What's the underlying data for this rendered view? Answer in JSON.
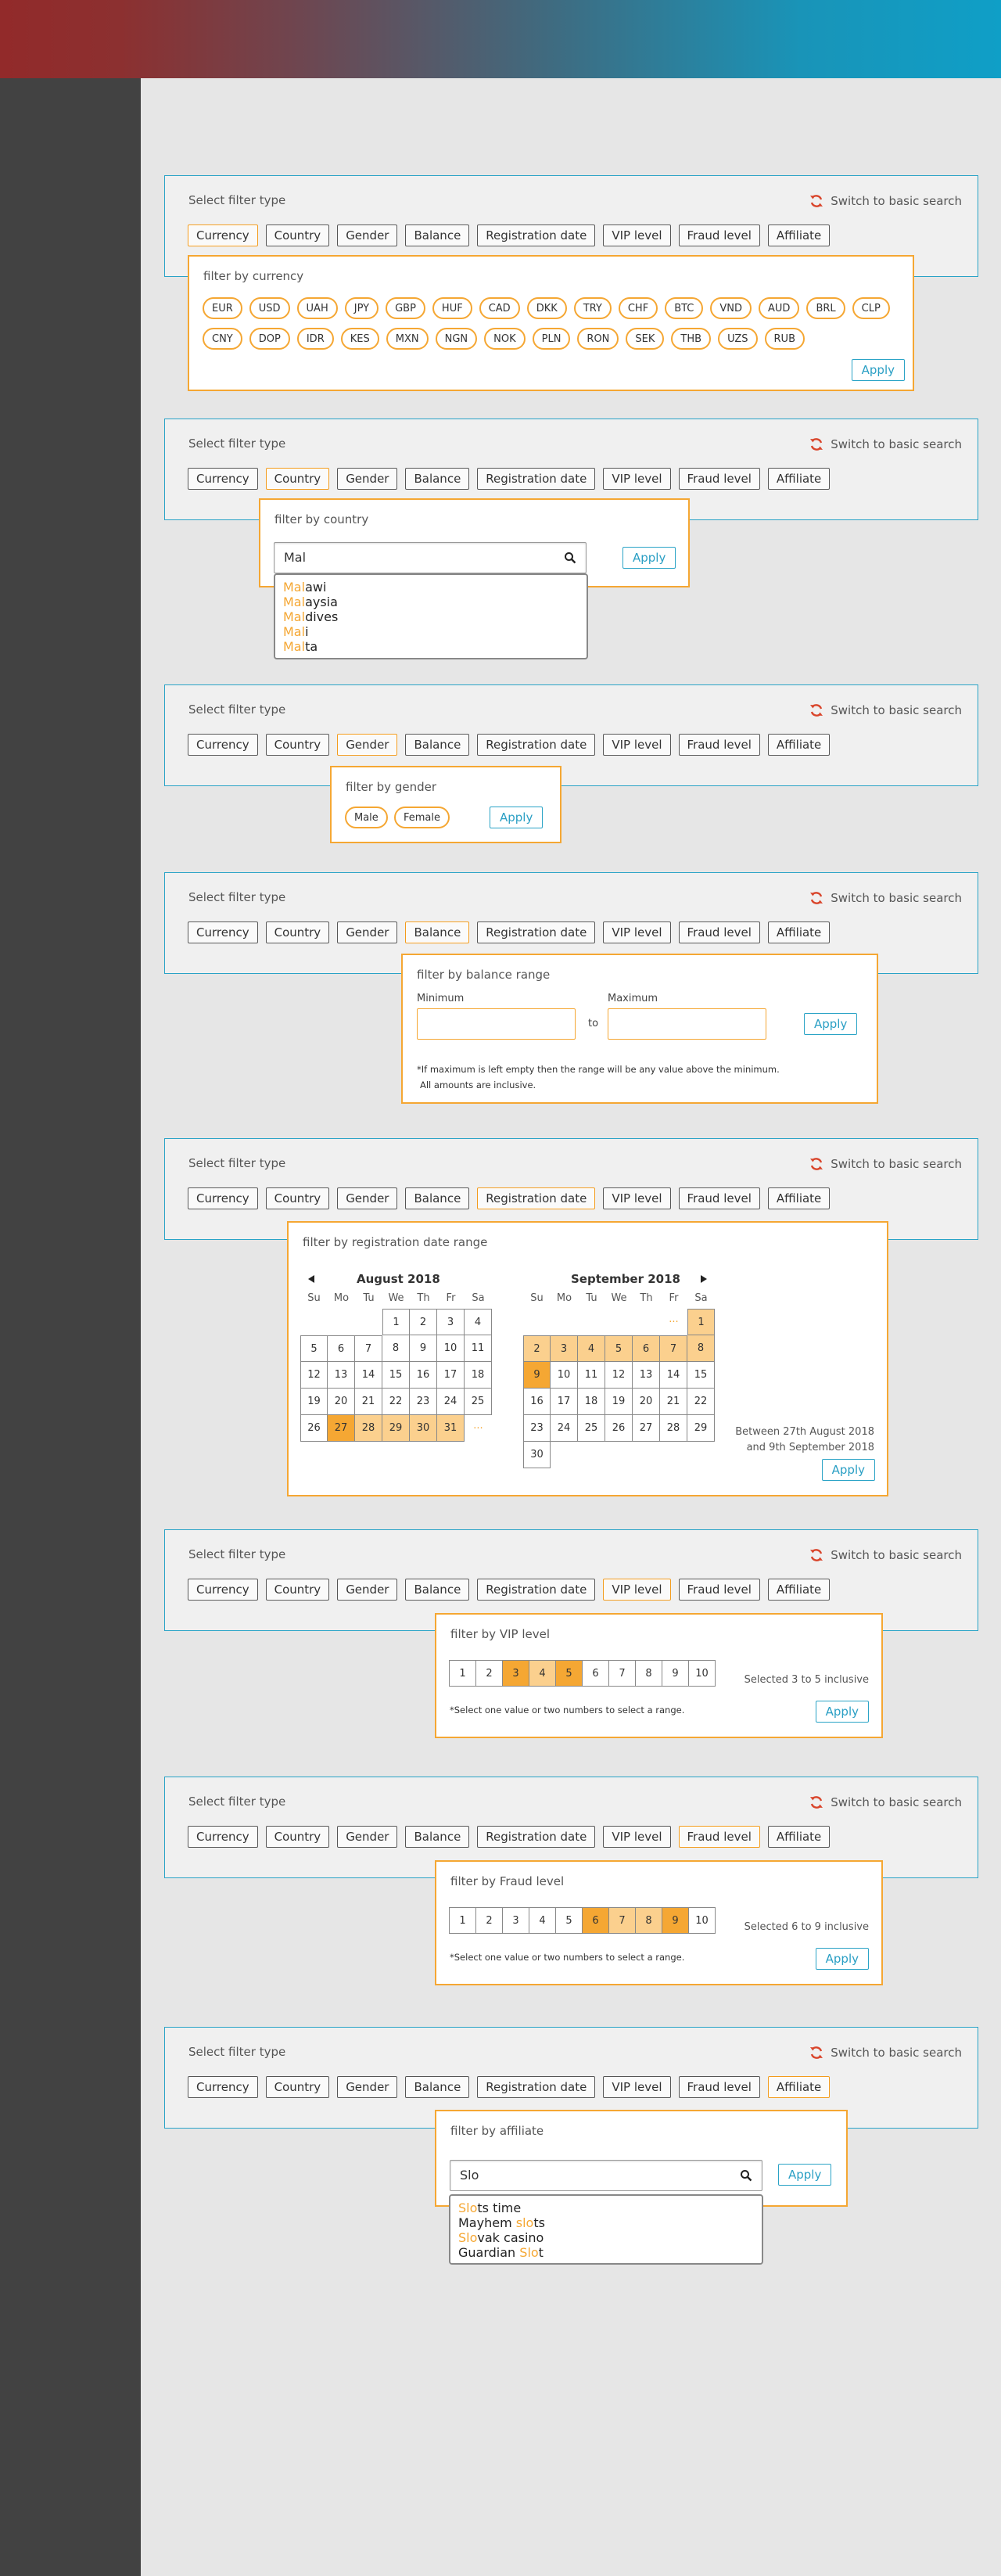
{
  "brand_colors": {
    "accent": "#f5a733",
    "link": "#2aa3c6",
    "sidebar": "#424242"
  },
  "panel": {
    "title": "Select filter type",
    "switch_label": "Switch to basic search",
    "filters": [
      "Currency",
      "Country",
      "Gender",
      "Balance",
      "Registration date",
      "VIP level",
      "Fraud level",
      "Affiliate"
    ]
  },
  "apply_label": "Apply",
  "currency": {
    "title": "filter by currency",
    "row1": [
      "EUR",
      "USD",
      "UAH",
      "JPY",
      "GBP",
      "HUF",
      "CAD",
      "DKK",
      "TRY",
      "CHF",
      "BTC",
      "VND",
      "AUD",
      "BRL",
      "CLP"
    ],
    "row2": [
      "CNY",
      "DOP",
      "IDR",
      "KES",
      "MXN",
      "NGN",
      "NOK",
      "PLN",
      "RON",
      "SEK",
      "THB",
      "UZS",
      "RUB"
    ]
  },
  "country": {
    "title": "filter by country",
    "query": "Mal",
    "results": [
      {
        "match": "Mal",
        "rest": "awi"
      },
      {
        "match": "Mal",
        "rest": "aysia"
      },
      {
        "match": "Mal",
        "rest": "dives"
      },
      {
        "match": "Mal",
        "rest": "i"
      },
      {
        "match": "Mal",
        "rest": "ta"
      }
    ]
  },
  "gender": {
    "title": "filter by gender",
    "options": [
      "Male",
      "Female"
    ]
  },
  "balance": {
    "title": "filter by balance range",
    "min_label": "Minimum",
    "max_label": "Maximum",
    "to_label": "to",
    "note1": "*If maximum is left empty then the range will be any value above the minimum.",
    "note2": "All amounts are inclusive."
  },
  "registration": {
    "title": "filter by registration date range",
    "prev_icon": "triangle-left-icon",
    "next_icon": "triangle-right-icon",
    "dow": [
      "Su",
      "Mo",
      "Tu",
      "We",
      "Th",
      "Fr",
      "Sa"
    ],
    "month1": "August 2018",
    "month2": "September 2018",
    "dots": "···",
    "range_line1": "Between 27th August 2018",
    "range_line2": "and 9th September 2018"
  },
  "vip": {
    "title": "filter by VIP level",
    "levels": [
      "1",
      "2",
      "3",
      "4",
      "5",
      "6",
      "7",
      "8",
      "9",
      "10"
    ],
    "range": [
      3,
      5
    ],
    "selected_text": "Selected 3 to 5 inclusive",
    "note": "*Select one value or two numbers to select a range."
  },
  "fraud": {
    "title": "filter by Fraud level",
    "levels": [
      "1",
      "2",
      "3",
      "4",
      "5",
      "6",
      "7",
      "8",
      "9",
      "10"
    ],
    "range": [
      6,
      9
    ],
    "selected_text": "Selected 6 to 9 inclusive",
    "note": "*Select one value or two numbers to select a range."
  },
  "affiliate": {
    "title": "filter by affiliate",
    "query": "Slo",
    "results": [
      {
        "pre": "",
        "match": "Slo",
        "post": "ts time"
      },
      {
        "pre": "Mayhem ",
        "match": "slo",
        "post": "ts"
      },
      {
        "pre": "",
        "match": "Slo",
        "post": "vak casino"
      },
      {
        "pre": "Guardian ",
        "match": "Slo",
        "post": "t"
      }
    ]
  }
}
